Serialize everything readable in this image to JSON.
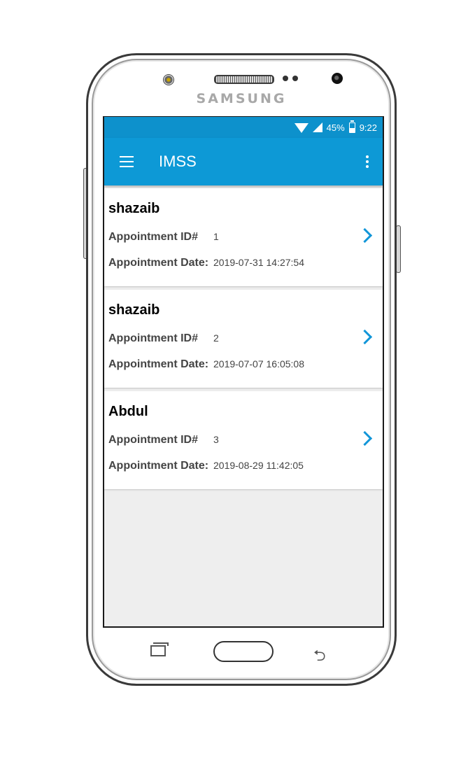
{
  "device": {
    "brand": "SAMSUNG"
  },
  "status_bar": {
    "battery": "45%",
    "time": "9:22",
    "signal_mark": "x"
  },
  "app_bar": {
    "title": "IMSS"
  },
  "labels": {
    "appointment_id": "Appointment ID#",
    "appointment_date": "Appointment Date:"
  },
  "appointments": [
    {
      "name": "shazaib",
      "id": "1",
      "date": "2019-07-31 14:27:54"
    },
    {
      "name": "shazaib",
      "id": "2",
      "date": "2019-07-07 16:05:08"
    },
    {
      "name": "Abdul",
      "id": "3",
      "date": "2019-08-29 11:42:05"
    }
  ],
  "colors": {
    "accent": "#0d99d6",
    "status_bar": "#0d91cc",
    "chevron": "#1296d8"
  }
}
